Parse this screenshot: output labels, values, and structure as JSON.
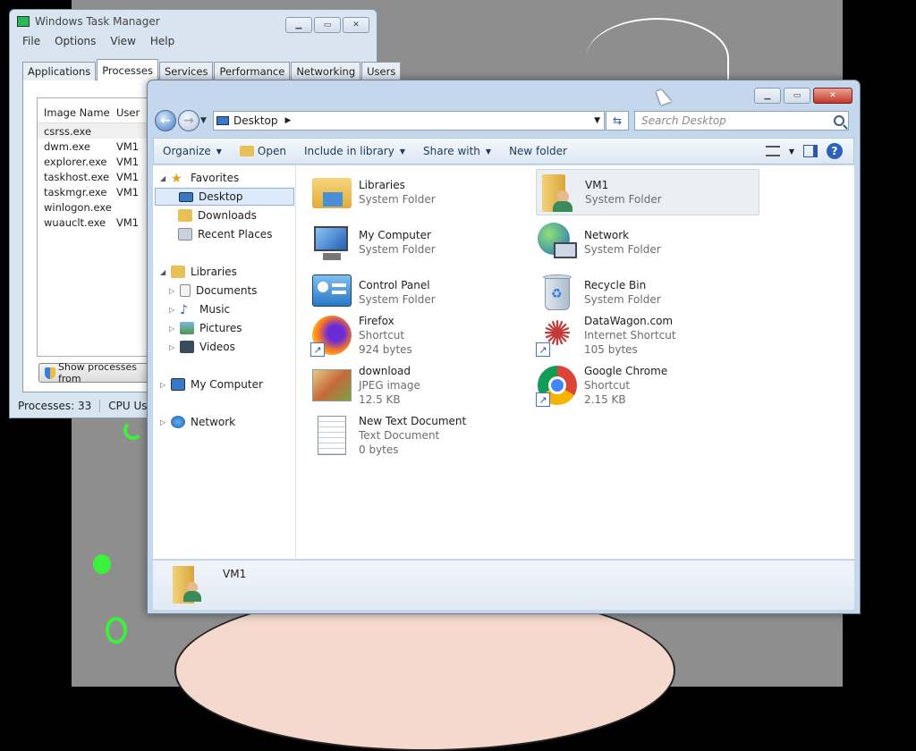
{
  "task_manager": {
    "title": "Windows Task Manager",
    "menu": [
      "File",
      "Options",
      "View",
      "Help"
    ],
    "tabs": [
      "Applications",
      "Processes",
      "Services",
      "Performance",
      "Networking",
      "Users"
    ],
    "active_tab": "Processes",
    "columns": [
      "Image Name",
      "User"
    ],
    "rows": [
      {
        "name": "csrss.exe",
        "user": ""
      },
      {
        "name": "dwm.exe",
        "user": "VM1"
      },
      {
        "name": "explorer.exe",
        "user": "VM1"
      },
      {
        "name": "taskhost.exe",
        "user": "VM1"
      },
      {
        "name": "taskmgr.exe",
        "user": "VM1"
      },
      {
        "name": "winlogon.exe",
        "user": ""
      },
      {
        "name": "wuauclt.exe",
        "user": "VM1"
      }
    ],
    "show_processes_label": "Show processes from",
    "status_processes": "Processes: 33",
    "status_cpu": "CPU Us"
  },
  "explorer": {
    "address": "Desktop",
    "search_placeholder": "Search Desktop",
    "toolbar": {
      "organize": "Organize",
      "open": "Open",
      "include": "Include in library",
      "share": "Share with",
      "new_folder": "New folder"
    },
    "nav": {
      "favorites": "Favorites",
      "desktop": "Desktop",
      "downloads": "Downloads",
      "recent": "Recent Places",
      "libraries": "Libraries",
      "documents": "Documents",
      "music": "Music",
      "pictures": "Pictures",
      "videos": "Videos",
      "computer": "My Computer",
      "network": "Network"
    },
    "items": [
      {
        "name": "Libraries",
        "line1": "System Folder",
        "line2": ""
      },
      {
        "name": "VM1",
        "line1": "System Folder",
        "line2": ""
      },
      {
        "name": "My Computer",
        "line1": "System Folder",
        "line2": ""
      },
      {
        "name": "Network",
        "line1": "System Folder",
        "line2": ""
      },
      {
        "name": "Control Panel",
        "line1": "System Folder",
        "line2": ""
      },
      {
        "name": "Recycle Bin",
        "line1": "System Folder",
        "line2": ""
      },
      {
        "name": "Firefox",
        "line1": "Shortcut",
        "line2": "924 bytes"
      },
      {
        "name": "DataWagon.com",
        "line1": "Internet Shortcut",
        "line2": "105 bytes"
      },
      {
        "name": "download",
        "line1": "JPEG image",
        "line2": "12.5 KB"
      },
      {
        "name": "Google Chrome",
        "line1": "Shortcut",
        "line2": "2.15 KB"
      },
      {
        "name": "New Text Document",
        "line1": "Text Document",
        "line2": "0 bytes"
      }
    ],
    "details_name": "VM1"
  }
}
